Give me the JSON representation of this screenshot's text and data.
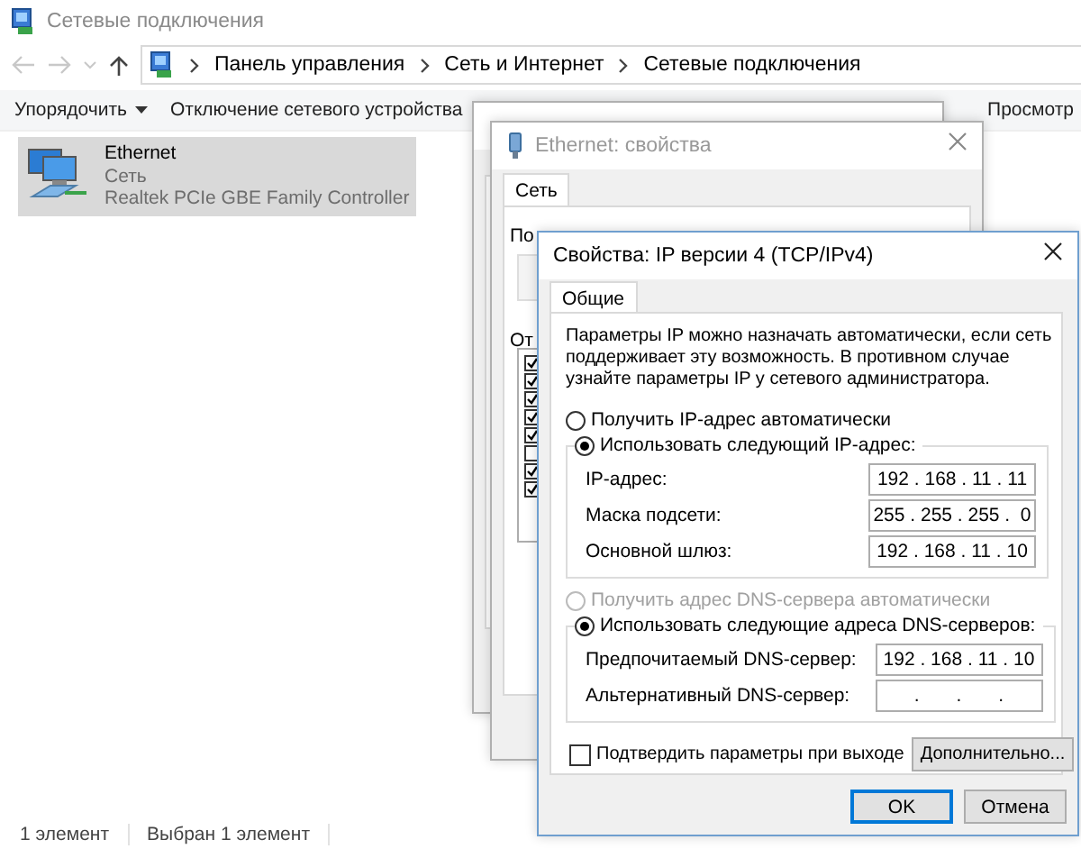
{
  "window": {
    "title": "Сетевые подключения"
  },
  "address_bar": {
    "path": [
      "Панель управления",
      "Сеть и Интернет",
      "Сетевые подключения"
    ]
  },
  "toolbar": [
    {
      "label": "Упорядочить",
      "kind": "menu"
    },
    {
      "label": "Отключение сетевого устройства",
      "kind": "button"
    },
    {
      "label": "Просмотр",
      "kind": "button"
    }
  ],
  "connections": [
    {
      "name": "Ethernet",
      "network": "Сеть",
      "adapter": "Realtek PCIe GBE Family Controller",
      "selected": true
    }
  ],
  "status_bar": [
    "1 элемент",
    "Выбран 1 элемент"
  ],
  "properties_dialog": {
    "title": "Ethernet: свойства",
    "tabs": [
      {
        "label": "Сеть",
        "selected": true
      }
    ],
    "fragments": [
      "По",
      "От"
    ],
    "components": [
      {
        "checked": true
      },
      {
        "checked": true
      },
      {
        "checked": true
      },
      {
        "checked": true
      },
      {
        "checked": true
      },
      {
        "checked": false
      },
      {
        "checked": true
      },
      {
        "checked": true
      }
    ]
  },
  "ipv4_dialog": {
    "title": "Свойства: IP версии 4 (TCP/IPv4)",
    "tabs": [
      {
        "label": "Общие",
        "selected": true
      }
    ],
    "description": "Параметры IP можно назначать автоматически, если сеть поддерживает эту возможность. В противном случае узнайте параметры IP у сетевого администратора.",
    "ip_auto": {
      "label": "Получить IP-адрес автоматически",
      "selected": false,
      "disabled": false
    },
    "ip_manual": {
      "label": "Использовать следующий IP-адрес:",
      "selected": true,
      "disabled": false
    },
    "ip_fields": [
      {
        "label": "IP-адрес:",
        "value": "192 . 168 . 11 . 11"
      },
      {
        "label": "Маска подсети:",
        "value": "255 . 255 . 255 .  0"
      },
      {
        "label": "Основной шлюз:",
        "value": "192 . 168 . 11 . 10"
      }
    ],
    "dns_auto": {
      "label": "Получить адрес DNS-сервера автоматически",
      "selected": false,
      "disabled": true
    },
    "dns_manual": {
      "label": "Использовать следующие адреса DNS-серверов:",
      "selected": true,
      "disabled": false
    },
    "dns_fields": [
      {
        "label": "Предпочитаемый DNS-сервер:",
        "value": "192 . 168 . 11 . 10"
      },
      {
        "label": "Альтернативный DNS-сервер:",
        "value": "      .       .       .      "
      }
    ],
    "validate": {
      "label": "Подтвердить параметры при выходе",
      "checked": false
    },
    "advanced_button": "Дополнительно...",
    "buttons": [
      {
        "label": "OK",
        "default": true
      },
      {
        "label": "Отмена",
        "default": false
      }
    ]
  }
}
